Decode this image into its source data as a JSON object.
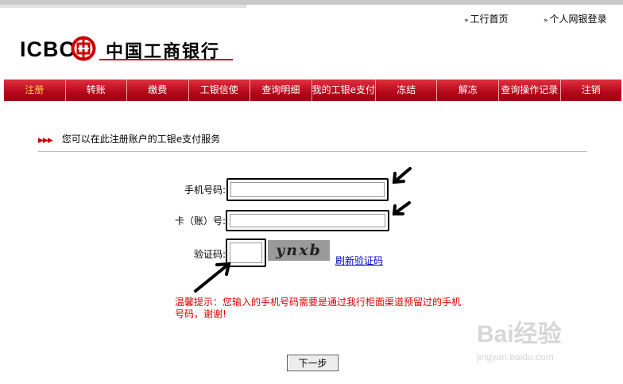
{
  "header": {
    "home_link": "工行首页",
    "login_link": "个人网银登录",
    "logo_en": "ICBC",
    "logo_cn": "中国工商银行",
    "brand_color": "#c00000"
  },
  "nav": {
    "items": [
      {
        "label": "注册"
      },
      {
        "label": "转账"
      },
      {
        "label": "缴费"
      },
      {
        "label": "工银信使"
      },
      {
        "label": "查询明细"
      },
      {
        "label": "我的工银e支付"
      },
      {
        "label": "冻结"
      },
      {
        "label": "解冻"
      },
      {
        "label": "查询操作记录"
      },
      {
        "label": "注销"
      }
    ],
    "active_index": 0
  },
  "section": {
    "title": "您可以在此注册账户的工银e支付服务"
  },
  "form": {
    "phone_label": "手机号码:",
    "card_label": "卡（账）号:",
    "captcha_label": "验证码:",
    "phone_value": "",
    "card_value": "",
    "captcha_value": "",
    "captcha_text": "ynxb",
    "refresh_link": "刷新验证码"
  },
  "notice": {
    "text": "温馨提示：您输入的手机号码需要是通过我行柜面渠道预留过的手机号码，谢谢!"
  },
  "buttons": {
    "next": "下一步"
  },
  "watermark": {
    "brand": "Bai经验",
    "url": "jingyan.baidu.com"
  }
}
